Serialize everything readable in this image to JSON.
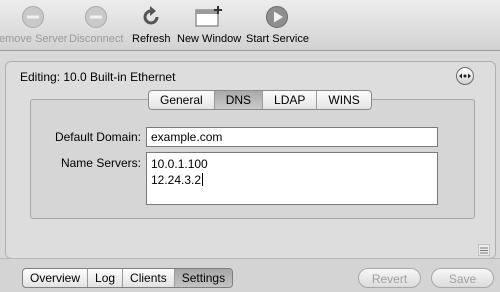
{
  "toolbar": {
    "remove_server": "emove Server",
    "disconnect": "Disconnect",
    "refresh": "Refresh",
    "new_window": "New Window",
    "start_service": "Start Service"
  },
  "editor": {
    "title": "Editing: 10.0 Built-in Ethernet",
    "tabs": [
      "General",
      "DNS",
      "LDAP",
      "WINS"
    ],
    "active_tab": "DNS",
    "default_domain_label": "Default Domain:",
    "default_domain_value": "example.com",
    "name_servers_label": "Name Servers:",
    "name_servers": [
      "10.0.1.100",
      "12.24.3.2"
    ]
  },
  "bottom": {
    "tabs": [
      "Overview",
      "Log",
      "Clients",
      "Settings"
    ],
    "active_tab": "Settings",
    "revert": "Revert",
    "save": "Save"
  },
  "icons": {
    "remove_server": "stop-circle-icon",
    "disconnect": "disconnect-icon",
    "refresh": "refresh-icon",
    "new_window": "new-window-icon",
    "start_service": "play-circle-icon",
    "info": "action-menu-icon"
  },
  "colors": {
    "disabled_text": "#9a9a9a",
    "active_tab": "#a9a9a9"
  }
}
